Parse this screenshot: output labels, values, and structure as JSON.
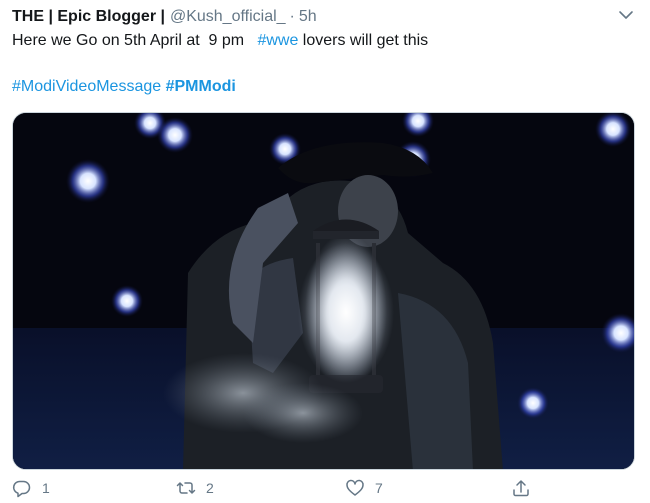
{
  "tweet": {
    "display_name": "THE | Epic Blogger |",
    "handle": "@Kush_official_",
    "separator": "·",
    "time": "5h",
    "text_line1_plain": "Here we Go on 5th April at  9 pm   ",
    "text_line1_hashtag": "#wwe",
    "text_line1_tail": " lovers will get this",
    "hashtag1": "#ModiVideoMessage",
    "hashtag2": "#PMModi",
    "media_icon": "photo-wrestler-with-lantern",
    "colors": {
      "link": "#1b95e0",
      "secondary": "#657786",
      "text": "#14171a",
      "border": "#ccd6dd"
    }
  },
  "actions": {
    "reply_count": "1",
    "retweet_count": "2",
    "like_count": "7",
    "icons": [
      "reply-icon",
      "retweet-icon",
      "like-icon",
      "share-icon"
    ]
  }
}
